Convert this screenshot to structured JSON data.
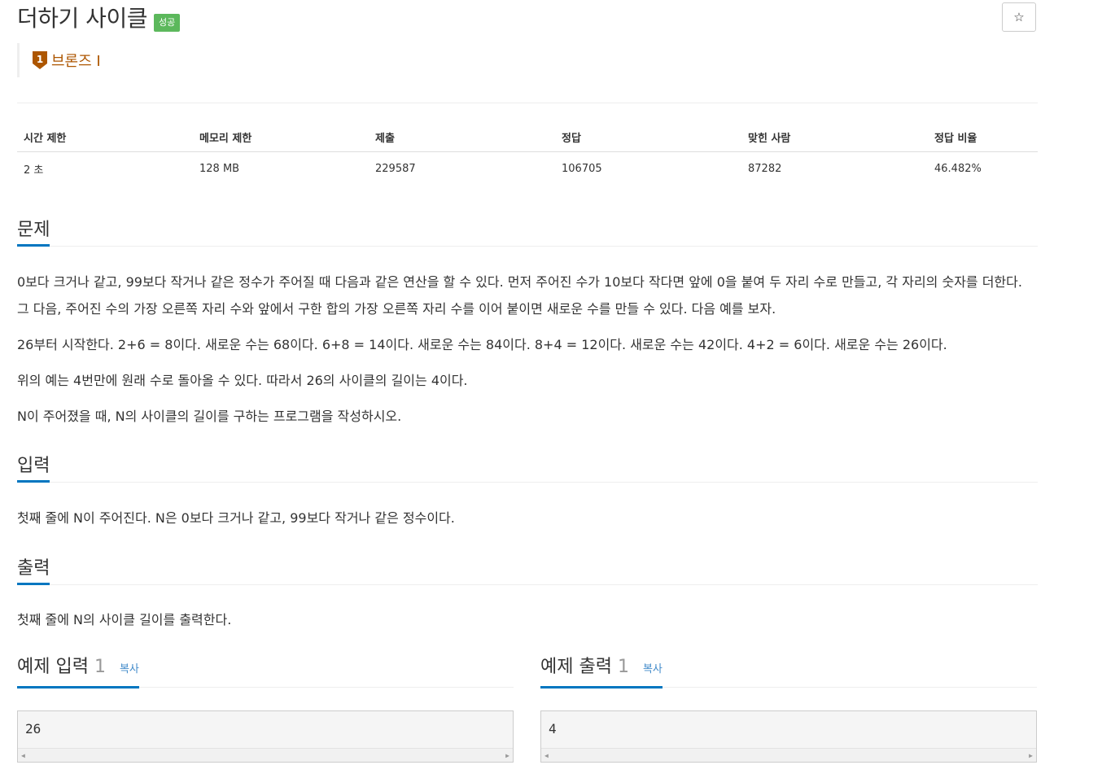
{
  "problem": {
    "title": "더하기 사이클",
    "status_badge": "성공",
    "star_icon": "☆",
    "tier": {
      "label": "브론즈 I",
      "number": "1",
      "color": "#ad5600"
    }
  },
  "info_table": {
    "headers": [
      "시간 제한",
      "메모리 제한",
      "제출",
      "정답",
      "맞힌 사람",
      "정답 비율"
    ],
    "values": [
      "2 초",
      "128 MB",
      "229587",
      "106705",
      "87282",
      "46.482%"
    ]
  },
  "sections": {
    "description": {
      "heading": "문제",
      "paragraphs": [
        "0보다 크거나 같고, 99보다 작거나 같은 정수가 주어질 때 다음과 같은 연산을 할 수 있다. 먼저 주어진 수가 10보다 작다면 앞에 0을 붙여 두 자리 수로 만들고, 각 자리의 숫자를 더한다. 그 다음, 주어진 수의 가장 오른쪽 자리 수와 앞에서 구한 합의 가장 오른쪽 자리 수를 이어 붙이면 새로운 수를 만들 수 있다. 다음 예를 보자.",
        "26부터 시작한다. 2+6 = 8이다. 새로운 수는 68이다. 6+8 = 14이다. 새로운 수는 84이다. 8+4 = 12이다. 새로운 수는 42이다. 4+2 = 6이다. 새로운 수는 26이다.",
        "위의 예는 4번만에 원래 수로 돌아올 수 있다. 따라서 26의 사이클의 길이는 4이다.",
        "N이 주어졌을 때, N의 사이클의 길이를 구하는 프로그램을 작성하시오."
      ]
    },
    "input": {
      "heading": "입력",
      "text": "첫째 줄에 N이 주어진다. N은 0보다 크거나 같고, 99보다 작거나 같은 정수이다."
    },
    "output": {
      "heading": "출력",
      "text": "첫째 줄에 N의 사이클 길이를 출력한다."
    }
  },
  "samples": {
    "input": {
      "heading": "예제 입력",
      "number": "1",
      "copy_label": "복사",
      "content": "26"
    },
    "output": {
      "heading": "예제 출력",
      "number": "1",
      "copy_label": "복사",
      "content": "4"
    }
  },
  "colors": {
    "accent": "#0076c0",
    "success_badge": "#5cb85c",
    "link": "#428bca"
  }
}
